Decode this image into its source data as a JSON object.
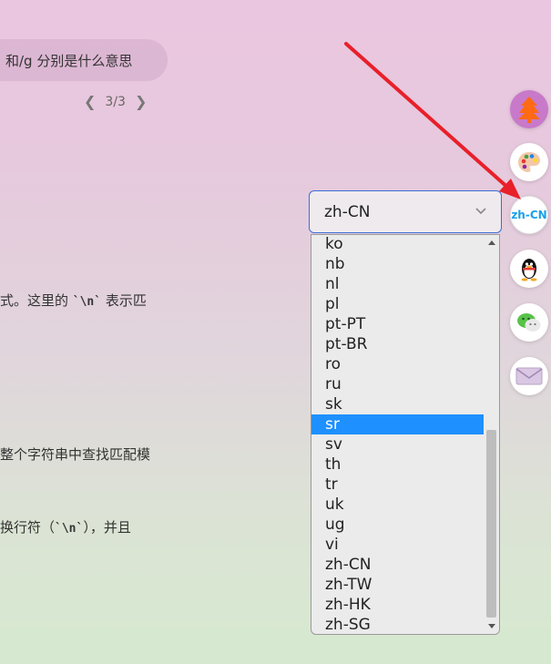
{
  "chat": {
    "bubble_text": "和/g 分别是什么意思"
  },
  "pager": {
    "value": "3/3"
  },
  "body_text": {
    "line1_pre": "式。这里的 ",
    "line1_code": "`\\n`",
    "line1_post": " 表示匹",
    "line2": "整个字符串中查找匹配模",
    "line3_pre": "换行符（",
    "line3_code": "`\\n`",
    "line3_post": "），并且"
  },
  "language_select": {
    "selected": "zh-CN",
    "options": [
      "ko",
      "nb",
      "nl",
      "pl",
      "pt-PT",
      "pt-BR",
      "ro",
      "ru",
      "sk",
      "sr",
      "sv",
      "th",
      "tr",
      "uk",
      "ug",
      "vi",
      "zh-CN",
      "zh-TW",
      "zh-HK",
      "zh-SG"
    ],
    "highlighted": "sr"
  },
  "sidebar": {
    "lang_label": "zh-CN"
  },
  "colors": {
    "highlight": "#1e90ff",
    "select_border": "#3b6fd6",
    "arrow": "#e8202a",
    "lang_text": "#1aa0e6"
  }
}
